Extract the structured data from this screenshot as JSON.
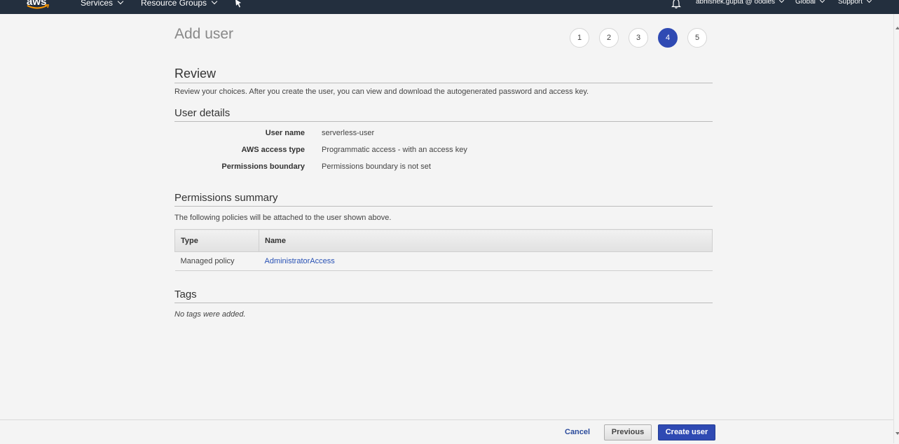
{
  "nav": {
    "services": "Services",
    "resource_groups": "Resource Groups",
    "account": "abhishek.gupta @ oodles",
    "region": "Global",
    "support": "Support",
    "logo_text": "aws"
  },
  "page": {
    "title": "Add user"
  },
  "steps": [
    "1",
    "2",
    "3",
    "4",
    "5"
  ],
  "active_step": 4,
  "review": {
    "heading": "Review",
    "description": "Review your choices. After you create the user, you can view and download the autogenerated password and access key."
  },
  "user_details": {
    "heading": "User details",
    "rows": [
      {
        "label": "User name",
        "value": "serverless-user"
      },
      {
        "label": "AWS access type",
        "value": "Programmatic access - with an access key"
      },
      {
        "label": "Permissions boundary",
        "value": "Permissions boundary is not set"
      }
    ]
  },
  "permissions": {
    "heading": "Permissions summary",
    "description": "The following policies will be attached to the user shown above.",
    "columns": [
      "Type",
      "Name"
    ],
    "rows": [
      {
        "type": "Managed policy",
        "name": "AdministratorAccess"
      }
    ]
  },
  "tags": {
    "heading": "Tags",
    "empty": "No tags were added."
  },
  "buttons": {
    "cancel": "Cancel",
    "previous": "Previous",
    "create": "Create user"
  },
  "colors": {
    "nav_bg": "#232f3e",
    "primary": "#2f4ab3",
    "link": "#2851b4"
  }
}
